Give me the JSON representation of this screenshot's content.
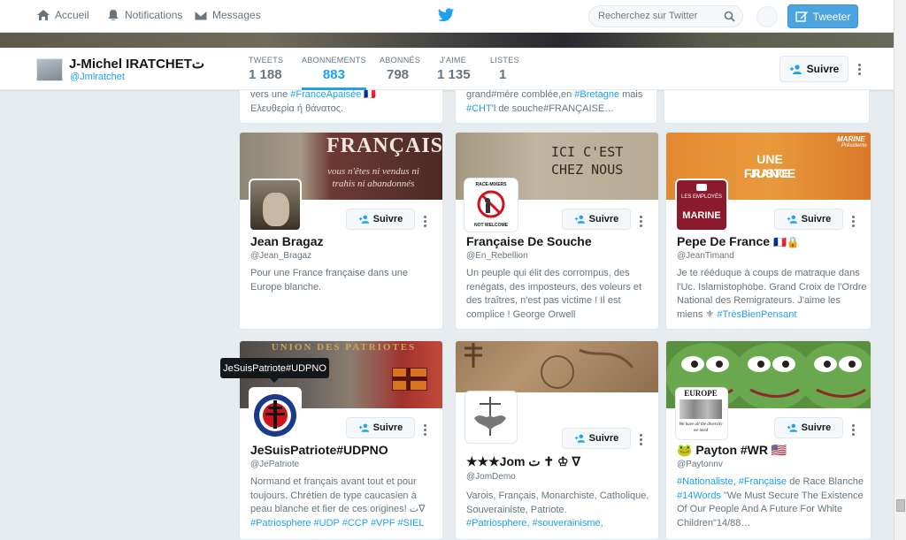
{
  "nav": {
    "home": "Accueil",
    "notifications": "Notifications",
    "messages": "Messages",
    "search_placeholder": "Recherchez sur Twitter",
    "tweet_button": "Tweeter"
  },
  "profile": {
    "name": "J-Michel IRATCHETت",
    "handle": "@Jmlratchet",
    "follow_label": "Suivre",
    "stats": [
      {
        "label": "TWEETS",
        "value": "1 188"
      },
      {
        "label": "ABONNEMENTS",
        "value": "883"
      },
      {
        "label": "ABONNÉS",
        "value": "798"
      },
      {
        "label": "J'AIME",
        "value": "1 135"
      },
      {
        "label": "LISTES",
        "value": "1"
      }
    ]
  },
  "top_cards": [
    {
      "bio_line1_pre": "vers une ",
      "bio_line1_tag": "#FranceApaisée",
      "bio_line1_post": " 🇫🇷",
      "bio_line2": "Ελευθερία ή θάνατος."
    },
    {
      "bio_line1_pre": "grand#mère comblée,en ",
      "bio_line1_tag": "#Bretagne",
      "bio_line1_post": " mais",
      "bio_line2_tag": "#CHT",
      "bio_line2_post": "'l de souche#FRANÇAISE…"
    }
  ],
  "cards": [
    {
      "name": "Jean Bragaz",
      "handle": "@Jean_Bragaz",
      "follow": "Suivre",
      "cover_text": "FRANÇAIS!",
      "cover_sub": "vous n'êtes ni vendus ni trahis ni abandonnés",
      "bio": "Pour une France française dans une Europe blanche."
    },
    {
      "name": "Française De Souche",
      "handle": "@En_Rebellion",
      "follow": "Suivre",
      "cover_text": "ICI C'EST CHEZ NOUS",
      "avatar_text_top": "RACE-MIXERS",
      "avatar_text_bottom": "NOT WELCOME",
      "bio": "Un peuple qui élit des corrompus, des renégats, des imposteurs, des voleurs et des traîtres, n'est pas victime ! Il est complice ! George Orwell"
    },
    {
      "name": "Pepe De France",
      "name_suffix": "🇫🇷🔒",
      "handle": "@JeanTimand",
      "follow": "Suivre",
      "cover_text_1": "UNE FRANCE",
      "cover_text_2": "JUSTE",
      "cover_brand": "MARINE",
      "cover_brand_sub": "Présidente",
      "avatar_text_top": "LES EMPLOYÉS",
      "avatar_text_mid": "MARINE",
      "bio_pre": "Je te rééduque à coups de matraque dans l'Uc. Islamistophobe. Grand Croix de l'Ordre National des Remigrateurs. J'aime les miens ⚜ ",
      "bio_tag": "#TrèsBienPensant"
    },
    {
      "name": "JeSuisPatriote#UDPNO",
      "handle": "@JePatriote",
      "follow": "Suivre",
      "cover_text": "UNION DES PATRIOTES",
      "tooltip": "JeSuisPatriote#UDPNO",
      "bio_pre": "Normand et français avant tout et pour toujours. Chrétien de type caucasien à peau blanche et fier de ces origines! ت∇",
      "bio_tags": "#Patriosphere #UDP #CCP #VPF #SIEL"
    },
    {
      "name": "★★★Jom ت ✝ ♔ ∇",
      "handle": "@JomDemo",
      "follow": "Suivre",
      "bio_pre": "Varois, Français, Monarchiste, Catholique, Souverainiste, Patriote.",
      "bio_tags": "#Patriosphere, #souverainisme,"
    },
    {
      "name": "🐸 Payton #WR 🇺🇸",
      "handle": "@Paytonnv",
      "follow": "Suivre",
      "avatar_text": "EUROPE",
      "avatar_sub": "We have all the diversity we need",
      "bio_tag1": "#Nationaliste",
      "bio_sep": ", ",
      "bio_tag2": "#Française",
      "bio_mid": " de Race Blanche ",
      "bio_tag3": "#14Words",
      "bio_post": " \"We Must Secure The Existence Of Our People And A Future For White Children\"14/88…"
    }
  ]
}
